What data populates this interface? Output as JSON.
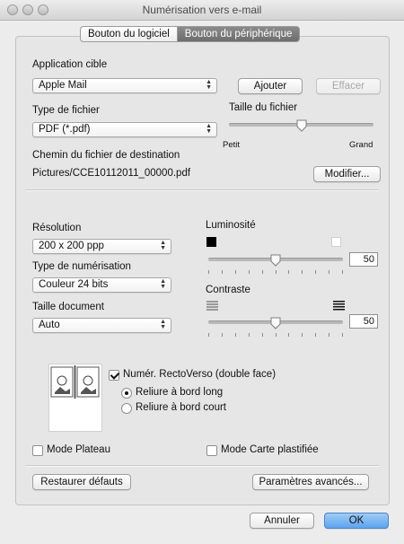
{
  "window": {
    "title": "Numérisation vers e-mail"
  },
  "tabs": [
    {
      "label": "Bouton du logiciel"
    },
    {
      "label": "Bouton du périphérique"
    }
  ],
  "app": {
    "label": "Application cible",
    "value": "Apple Mail",
    "add_label": "Ajouter",
    "clear_label": "Effacer"
  },
  "file_type": {
    "label": "Type de fichier",
    "value": "PDF (*.pdf)"
  },
  "file_size": {
    "label": "Taille du fichier",
    "min_label": "Petit",
    "max_label": "Grand",
    "level": 0.5
  },
  "destination": {
    "label": "Chemin du fichier de destination",
    "path": "Pictures/CCE10112011_00000.pdf",
    "modify_label": "Modifier..."
  },
  "resolution": {
    "label": "Résolution",
    "value": "200 x 200 ppp"
  },
  "scan_type": {
    "label": "Type de numérisation",
    "value": "Couleur 24 bits"
  },
  "doc_size": {
    "label": "Taille document",
    "value": "Auto"
  },
  "brightness": {
    "label": "Luminosité",
    "value": "50",
    "level": 0.5
  },
  "contrast": {
    "label": "Contraste",
    "value": "50",
    "level": 0.5
  },
  "duplex": {
    "label": "Numér. RectoVerso (double face)",
    "checked": true,
    "options": [
      {
        "label": "Reliure à bord long",
        "selected": true
      },
      {
        "label": "Reliure à bord court",
        "selected": false
      }
    ]
  },
  "flatbed": {
    "label": "Mode Plateau",
    "checked": false
  },
  "plastic_card": {
    "label": "Mode Carte plastifiée",
    "checked": false
  },
  "buttons": {
    "restore_defaults": "Restaurer défauts",
    "advanced": "Paramètres avancés...",
    "cancel": "Annuler",
    "ok": "OK"
  },
  "colors": {
    "accent": "#5ea4ef",
    "tab_active": "#7a7a7a"
  }
}
